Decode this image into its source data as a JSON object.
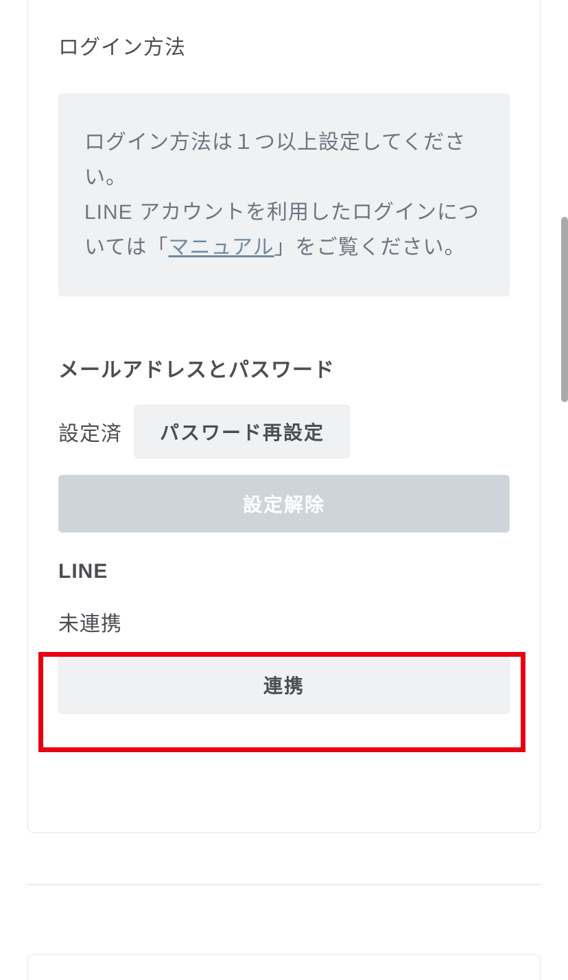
{
  "login": {
    "title": "ログイン方法",
    "info_prefix": "ログイン方法は１つ以上設定してください。\nLINE アカウントを利用したログインについては「",
    "info_link": "マニュアル",
    "info_suffix": "」をご覧ください。"
  },
  "email": {
    "heading": "メールアドレスとパスワード",
    "status": "設定済",
    "reset_label": "パスワード再設定",
    "clear_label": "設定解除"
  },
  "line": {
    "heading": "LINE",
    "status": "未連携",
    "link_label": "連携"
  }
}
